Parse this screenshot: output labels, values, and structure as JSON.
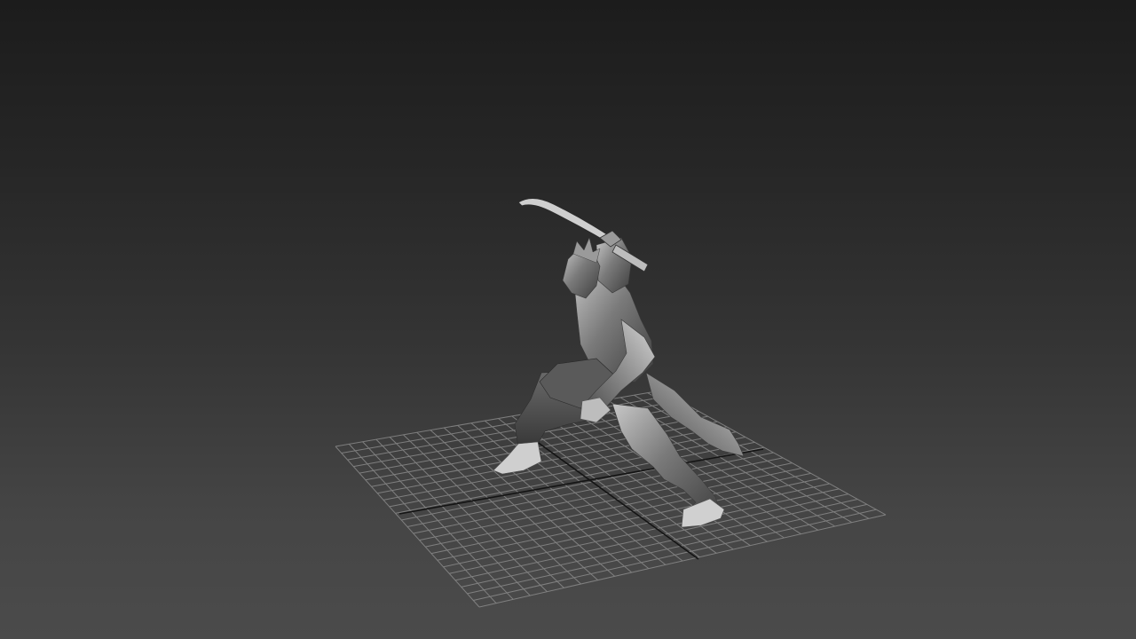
{
  "viewport": {
    "type": "3d-perspective-view",
    "background_top": "#1c1c1c",
    "background_bottom": "#4b4b4b",
    "grid_color": "#8a8a8a",
    "axis_color": "#141414"
  },
  "scene": {
    "objects": [
      {
        "name": "home-grid",
        "kind": "grid"
      },
      {
        "name": "warrior-character-model",
        "kind": "mesh",
        "material_color": "#8c8c8c"
      },
      {
        "name": "curved-sword",
        "kind": "mesh"
      }
    ]
  }
}
